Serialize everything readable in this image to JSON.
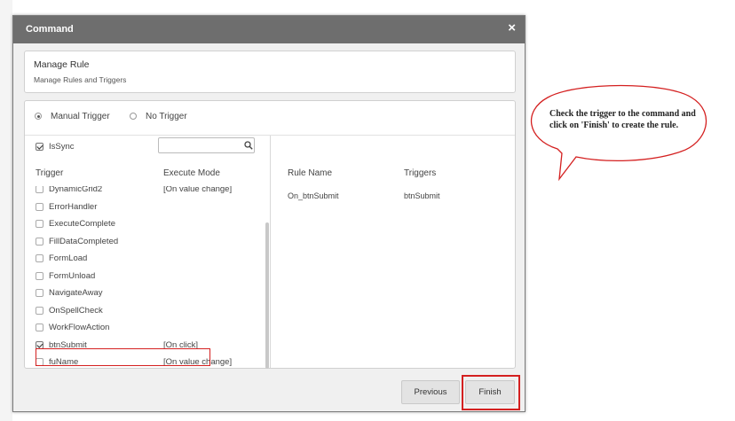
{
  "dialog": {
    "title": "Command",
    "close_icon": "close-icon",
    "close_glyph": "×"
  },
  "manage": {
    "title": "Manage Rule",
    "subtitle": "Manage Rules and Triggers"
  },
  "trigger_options": {
    "manual": "Manual Trigger",
    "none": "No Trigger",
    "selected": "manual"
  },
  "issync": {
    "label": "IsSync",
    "checked": true
  },
  "search": {
    "value": "",
    "placeholder": "",
    "icon": "search-icon"
  },
  "left_headers": {
    "trigger": "Trigger",
    "execute_mode": "Execute Mode"
  },
  "trigger_rows": [
    {
      "name": "DynamicGrid2",
      "mode": "[On value change]",
      "checked": false
    },
    {
      "name": "ErrorHandler",
      "mode": "",
      "checked": false
    },
    {
      "name": "ExecuteComplete",
      "mode": "",
      "checked": false
    },
    {
      "name": "FillDataCompleted",
      "mode": "",
      "checked": false
    },
    {
      "name": "FormLoad",
      "mode": "",
      "checked": false
    },
    {
      "name": "FormUnload",
      "mode": "",
      "checked": false
    },
    {
      "name": "NavigateAway",
      "mode": "",
      "checked": false
    },
    {
      "name": "OnSpellCheck",
      "mode": "",
      "checked": false
    },
    {
      "name": "WorkFlowAction",
      "mode": "",
      "checked": false
    },
    {
      "name": "btnSubmit",
      "mode": "[On click]",
      "checked": true
    },
    {
      "name": "fuName",
      "mode": "[On value change]",
      "checked": false
    }
  ],
  "right_headers": {
    "rule_name": "Rule Name",
    "triggers": "Triggers"
  },
  "rules": [
    {
      "rule_name": "On_btnSubmit",
      "triggers": "btnSubmit"
    }
  ],
  "buttons": {
    "previous": "Previous",
    "finish": "Finish"
  },
  "callout": {
    "text": "Check the trigger to the command and click on 'Finish' to create the rule."
  },
  "colors": {
    "header": "#6e6e6e",
    "highlight": "#d42020",
    "button": "#e3e3e3"
  }
}
